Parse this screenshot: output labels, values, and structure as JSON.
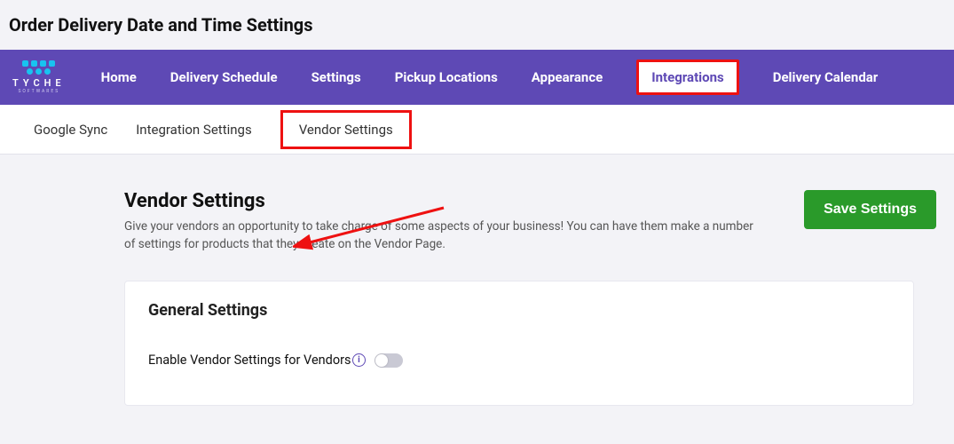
{
  "page_title": "Order Delivery Date and Time Settings",
  "logo": {
    "name": "TYCHE",
    "sub": "SOFTWARES"
  },
  "nav": [
    {
      "label": "Home"
    },
    {
      "label": "Delivery Schedule"
    },
    {
      "label": "Settings"
    },
    {
      "label": "Pickup Locations"
    },
    {
      "label": "Appearance"
    },
    {
      "label": "Integrations",
      "active": true
    },
    {
      "label": "Delivery Calendar"
    }
  ],
  "subnav": [
    {
      "label": "Google Sync"
    },
    {
      "label": "Integration Settings"
    },
    {
      "label": "Vendor Settings",
      "active": true
    }
  ],
  "section": {
    "title": "Vendor Settings",
    "desc": "Give your vendors an opportunity to take charge of some aspects of your business! You can have them make a number of settings for products that they create on the Vendor Page."
  },
  "save_button": "Save Settings",
  "card": {
    "title": "General Settings",
    "setting_label": "Enable Vendor Settings for Vendors",
    "toggle_on": false
  }
}
